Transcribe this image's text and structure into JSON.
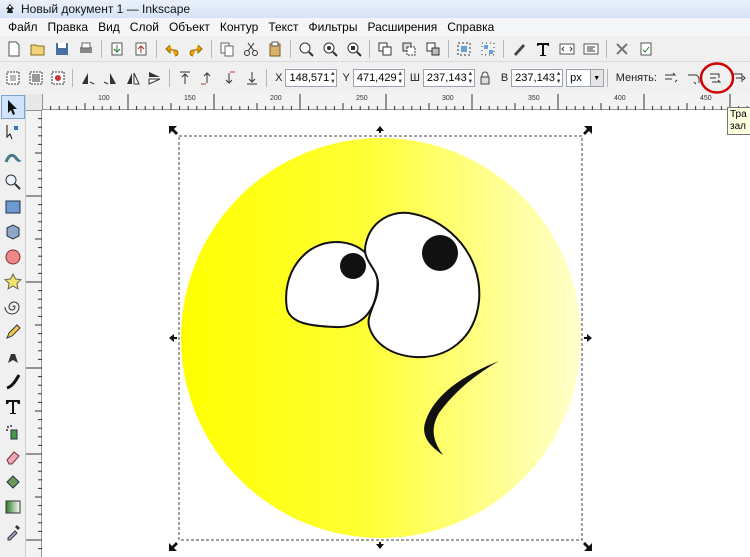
{
  "window": {
    "title": "Новый документ 1 — Inkscape"
  },
  "menu": [
    {
      "label": "Файл"
    },
    {
      "label": "Правка"
    },
    {
      "label": "Вид"
    },
    {
      "label": "Слой"
    },
    {
      "label": "Объект"
    },
    {
      "label": "Контур"
    },
    {
      "label": "Текст"
    },
    {
      "label": "Фильтры"
    },
    {
      "label": "Расширения"
    },
    {
      "label": "Справка"
    }
  ],
  "controls": {
    "x_label": "X",
    "x_value": "148,571",
    "y_label": "Y",
    "y_value": "471,429",
    "w_label": "Ш",
    "w_value": "237,143",
    "h_label": "В",
    "h_value": "237,143",
    "unit": "px",
    "change_label": "Менять:"
  },
  "ruler": {
    "ticks": [
      "100",
      "150",
      "200",
      "250",
      "300",
      "350",
      "400",
      "450"
    ]
  },
  "tooltip": {
    "line1": "Тра",
    "line2": "зал"
  },
  "icons": {
    "toolbox": [
      "select-arrow-icon",
      "node-edit-icon",
      "tweak-icon",
      "zoom-icon",
      "rectangle-icon",
      "box-3d-icon",
      "ellipse-icon",
      "star-icon",
      "spiral-icon",
      "pencil-icon",
      "pen-icon",
      "calligraphy-icon",
      "text-icon",
      "spray-icon",
      "eraser-icon",
      "paint-bucket-icon",
      "gradient-icon",
      "dropper-icon"
    ]
  },
  "colors": {
    "face_left": "#ffff00",
    "face_right": "#ffffc8",
    "highlight_ring": "#d00000"
  }
}
